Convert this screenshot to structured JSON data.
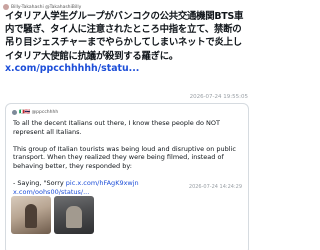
{
  "tweet": {
    "author": "Billy-Takahashi @TakahashiBilly",
    "text": "イタリア人学生グループがバンコクの公共交通機関BTS車内で騒ぎ、タイ人に注意されたところ中指を立て、禁断の吊り目ジェスチャーまでやらかしてしまいネットで炎上しイタリア大使館に抗議が殺到する羅ぎに。",
    "link": "x.com/ppcchhhhh/statu...",
    "timestamp": "2026-07-24 19:55:05"
  },
  "quote": {
    "author": "🇮🇹🇹🇭 @ppcchhhh",
    "paragraphs": [
      "To all the decent Italians out there, I know these people do NOT represent all Italians.",
      "This group of Italian tourists was being loud and disruptive on public transport. When they realized they were being filmed, instead of behaving better, they responded by:"
    ],
    "said_prefix": "- Saying, \"Sorry ",
    "said_link1": "pic.x.com/hFAgK9xwjn",
    "said_link2": "x.com/oohs00/status/...",
    "timestamp": "2026-07-24 14:24:29"
  }
}
